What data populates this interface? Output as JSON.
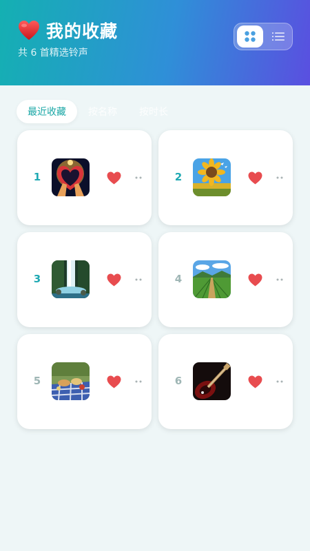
{
  "header": {
    "title": "我的收藏",
    "subtitle": "共 6 首精选铃声"
  },
  "tabs": [
    {
      "label": "最近收藏",
      "active": true
    },
    {
      "label": "按名称",
      "active": false
    },
    {
      "label": "按时长",
      "active": false
    }
  ],
  "items": [
    {
      "rank": "1",
      "cover": "heart-hands"
    },
    {
      "rank": "2",
      "cover": "sunflower-field"
    },
    {
      "rank": "3",
      "cover": "waterfall"
    },
    {
      "rank": "4",
      "cover": "farm-field"
    },
    {
      "rank": "5",
      "cover": "picnic"
    },
    {
      "rank": "6",
      "cover": "guitar"
    }
  ],
  "colors": {
    "accent": "#1aa7a6",
    "favorite": "#e84c4f",
    "header_start": "#14b0b2",
    "header_end": "#5a4fe0"
  }
}
